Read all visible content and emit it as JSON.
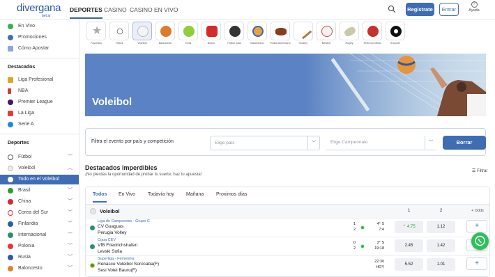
{
  "header": {
    "logo_text": "divergana",
    "logo_sub": "bet.ar",
    "nav": [
      "DEPORTES",
      "CASINO",
      "CASINO EN VIVO"
    ],
    "register_label": "Registrate",
    "login_label": "Entrar",
    "help_label": "Ayuda"
  },
  "sidebar": {
    "top_items": [
      "En Vivo",
      "Promociones",
      "Cómo Apostar"
    ],
    "featured_title": "Destacados",
    "featured": [
      "Liga Profesional",
      "NBA",
      "Premier League",
      "La Liga",
      "Serie A"
    ],
    "sports_title": "Deportes",
    "sports": [
      "Fútbol",
      "Voleibol"
    ],
    "all_label": "Todo en el Voleibol",
    "countries": [
      "Brasil",
      "China",
      "Corea del Sur",
      "Finlandia",
      "Internacional",
      "Polonia",
      "Rusia"
    ],
    "last_sport": "Baloncesto"
  },
  "sports_bar": [
    "Favoritos",
    "Fútbol",
    "Voleibol",
    "Baloncesto",
    "Tenis",
    "Boxeo",
    "Fútbol Sala",
    "Balonmano",
    "Fútbol Americano",
    "Hockey",
    "Béisbol",
    "Rugby",
    "Tenis De Mesa",
    "Snooker"
  ],
  "banner": {
    "title": "Voleibol"
  },
  "filter": {
    "label": "Filtra el evento por país y competición",
    "country_placeholder": "Elige país",
    "championship_placeholder": "Elige Campeonato",
    "clear_label": "Borrar"
  },
  "highlights": {
    "title": "Destacados imperdibles",
    "subtitle": "¡No pierdas la oportunidad de probar tu suerte, haz tu apuesta!",
    "filter_label": "Filtrar"
  },
  "tabs": [
    "Todos",
    "En Vivo",
    "Todavía hoy",
    "Mañana",
    "Proximos días"
  ],
  "section": {
    "title": "Voleibol",
    "col1": "1",
    "col2": "2",
    "col3": "+ Odds"
  },
  "events": [
    {
      "league": "Liga de Campeones - Grupo C",
      "team1": "CV Guaguas",
      "team2": "Perugia Volley",
      "score1": "1",
      "score2": "2",
      "meta1": "4° S",
      "meta2": "7:4",
      "odd1": "4.75",
      "odd2": "1.12",
      "more": "+"
    },
    {
      "league": "Copa CEV",
      "team1": "VfB Friedrichshafen",
      "team2": "Levski Sofia",
      "score1": "0",
      "score2": "2",
      "meta1": "3° S",
      "meta2": "19:18",
      "odd1": "2.45",
      "odd2": "1.42",
      "more": "+"
    },
    {
      "league": "Superliga - Femenina",
      "team1": "Renasce Voleibol Sorocaba(F)",
      "team2": "Sesi Volei Bauru(F)",
      "score1": "",
      "score2": "",
      "meta1": "22:30",
      "meta2": "HOY",
      "odd1": "5.52",
      "odd2": "1.01",
      "more": "+"
    }
  ]
}
